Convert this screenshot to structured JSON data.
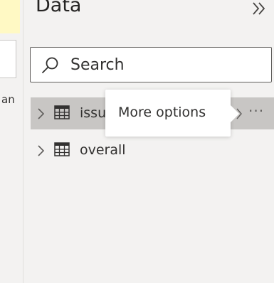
{
  "pane": {
    "title": "Data",
    "collapse_icon": "double-chevron-right-icon",
    "search": {
      "placeholder": "Search",
      "value": ""
    },
    "tables": [
      {
        "label": "issu",
        "icon": "table-icon",
        "selected": true,
        "more_label": "···"
      },
      {
        "label": "overall",
        "icon": "table-icon",
        "selected": false
      }
    ],
    "tooltip": {
      "text": "More options"
    }
  },
  "left_strip": {
    "text": "an"
  },
  "colors": {
    "pane_bg": "#f3f2f1",
    "selected_row": "#c8c6c4",
    "text": "#323130",
    "yellow": "#fff9c4"
  }
}
